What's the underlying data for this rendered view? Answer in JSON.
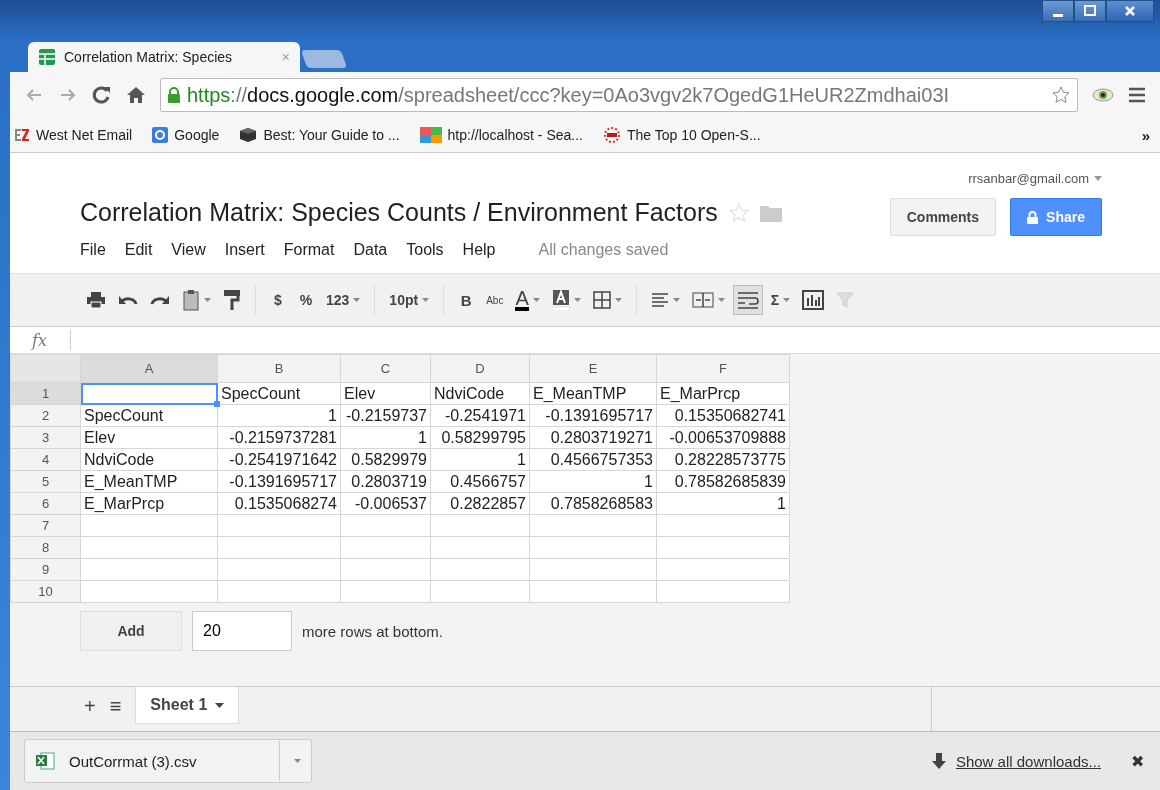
{
  "browser": {
    "tab": {
      "title": "Correlation Matrix: Species",
      "close": "×",
      "selected": true
    },
    "address": {
      "scheme": "https",
      "separator": "://",
      "host": "docs.google.com",
      "path": "/spreadsheet/ccc?key=0Ao3vgv2k7OgedG1HeUR2Zmdhai03I"
    },
    "bookmarks": [
      {
        "kind": "ez",
        "label": "West Net Email"
      },
      {
        "kind": "google",
        "label": "Google"
      },
      {
        "kind": "box",
        "label": "Best: Your Guide to ..."
      },
      {
        "kind": "tiles",
        "label": "htp://localhost - Sea..."
      },
      {
        "kind": "crm",
        "label": "The Top 10 Open-S..."
      }
    ],
    "more": "»"
  },
  "doc": {
    "account": "rrsanbar@gmail.com",
    "title": "Correlation Matrix: Species Counts / Environment Factors",
    "starred": false,
    "comments": "Comments",
    "share": "Share",
    "menu": [
      "File",
      "Edit",
      "View",
      "Insert",
      "Format",
      "Data",
      "Tools",
      "Help"
    ],
    "status": "All changes saved"
  },
  "toolbar": [
    {
      "kind": "print",
      "dropdown": false
    },
    {
      "kind": "undo",
      "dropdown": false
    },
    {
      "kind": "redo",
      "dropdown": false
    },
    {
      "kind": "paste",
      "dropdown": true
    },
    {
      "kind": "roller",
      "dropdown": false
    },
    {
      "kind": "sep"
    },
    {
      "kind": "text",
      "label": "$",
      "dropdown": false
    },
    {
      "kind": "text",
      "label": "%",
      "dropdown": false
    },
    {
      "kind": "text",
      "label": "123",
      "dropdown": true
    },
    {
      "kind": "sep"
    },
    {
      "kind": "text",
      "label": "10pt",
      "dropdown": true
    },
    {
      "kind": "sep"
    },
    {
      "kind": "bold",
      "label": "B",
      "dropdown": false
    },
    {
      "kind": "strike",
      "label": "Abc",
      "dropdown": false
    },
    {
      "kind": "textcolor",
      "label": "A",
      "dropdown": true
    },
    {
      "kind": "fill",
      "dropdown": true
    },
    {
      "kind": "borders",
      "dropdown": true
    },
    {
      "kind": "sep"
    },
    {
      "kind": "align",
      "dropdown": true
    },
    {
      "kind": "merge",
      "dropdown": true
    },
    {
      "kind": "wrap",
      "dropdown": false,
      "pressed": true
    },
    {
      "kind": "text",
      "label": "Σ",
      "dropdown": true
    },
    {
      "kind": "chart",
      "dropdown": false
    },
    {
      "kind": "filter",
      "dropdown": false,
      "disabled": true
    }
  ],
  "formula_bar": {
    "label": "fx"
  },
  "grid": {
    "columns": [
      {
        "label": "A",
        "selected": true
      },
      {
        "label": "B",
        "selected": false
      },
      {
        "label": "C",
        "selected": false
      },
      {
        "label": "D",
        "selected": false
      },
      {
        "label": "E",
        "selected": false
      },
      {
        "label": "F",
        "selected": false
      }
    ],
    "rows": [
      {
        "label": "1",
        "selected": true,
        "cells": [
          {
            "kind": "empty",
            "selected": true
          },
          {
            "kind": "text",
            "text": "SpecCount",
            "selected": false
          },
          {
            "kind": "text",
            "text": "Elev",
            "selected": false
          },
          {
            "kind": "text",
            "text": "NdviCode",
            "selected": false
          },
          {
            "kind": "text",
            "text": "E_MeanTMP",
            "selected": false
          },
          {
            "kind": "text",
            "text": "E_MarPrcp",
            "selected": false
          }
        ]
      },
      {
        "label": "2",
        "selected": false,
        "cells": [
          {
            "kind": "text",
            "text": "SpecCount",
            "selected": false
          },
          {
            "kind": "number",
            "text": "1",
            "selected": false
          },
          {
            "kind": "number",
            "text": "-0.2159737",
            "selected": false
          },
          {
            "kind": "number",
            "text": "-0.2541971",
            "selected": false
          },
          {
            "kind": "number",
            "text": "-0.1391695717",
            "selected": false
          },
          {
            "kind": "number",
            "text": "0.15350682741",
            "selected": false
          }
        ]
      },
      {
        "label": "3",
        "selected": false,
        "cells": [
          {
            "kind": "text",
            "text": "Elev",
            "selected": false
          },
          {
            "kind": "number",
            "text": "-0.2159737281",
            "selected": false
          },
          {
            "kind": "number",
            "text": "1",
            "selected": false
          },
          {
            "kind": "number",
            "text": "0.58299795",
            "selected": false
          },
          {
            "kind": "number",
            "text": "0.2803719271",
            "selected": false
          },
          {
            "kind": "number",
            "text": "-0.00653709888",
            "selected": false
          }
        ]
      },
      {
        "label": "4",
        "selected": false,
        "cells": [
          {
            "kind": "text",
            "text": "NdviCode",
            "selected": false
          },
          {
            "kind": "number",
            "text": "-0.2541971642",
            "selected": false
          },
          {
            "kind": "number",
            "text": "0.5829979",
            "selected": false
          },
          {
            "kind": "number",
            "text": "1",
            "selected": false
          },
          {
            "kind": "number",
            "text": "0.4566757353",
            "selected": false
          },
          {
            "kind": "number",
            "text": "0.28228573775",
            "selected": false
          }
        ]
      },
      {
        "label": "5",
        "selected": false,
        "cells": [
          {
            "kind": "text",
            "text": "E_MeanTMP",
            "selected": false
          },
          {
            "kind": "number",
            "text": "-0.1391695717",
            "selected": false
          },
          {
            "kind": "number",
            "text": "0.2803719",
            "selected": false
          },
          {
            "kind": "number",
            "text": "0.4566757",
            "selected": false
          },
          {
            "kind": "number",
            "text": "1",
            "selected": false
          },
          {
            "kind": "number",
            "text": "0.78582685839",
            "selected": false
          }
        ]
      },
      {
        "label": "6",
        "selected": false,
        "cells": [
          {
            "kind": "text",
            "text": "E_MarPrcp",
            "selected": false
          },
          {
            "kind": "number",
            "text": "0.1535068274",
            "selected": false
          },
          {
            "kind": "number",
            "text": "-0.006537",
            "selected": false
          },
          {
            "kind": "number",
            "text": "0.2822857",
            "selected": false
          },
          {
            "kind": "number",
            "text": "0.7858268583",
            "selected": false
          },
          {
            "kind": "number",
            "text": "1",
            "selected": false
          }
        ]
      },
      {
        "label": "7",
        "selected": false
      },
      {
        "label": "8",
        "selected": false
      },
      {
        "label": "9",
        "selected": false
      },
      {
        "label": "10",
        "selected": false
      }
    ]
  },
  "add_rows": {
    "button": "Add",
    "value": "20",
    "suffix": "more rows at bottom."
  },
  "sheets": {
    "add": "+",
    "list": "≡",
    "tabs": [
      {
        "label": "Sheet 1",
        "selected": true
      }
    ]
  },
  "downloads": {
    "file": "OutCorrmat (3).csv",
    "show_all": "Show all downloads...",
    "close": "✖"
  }
}
